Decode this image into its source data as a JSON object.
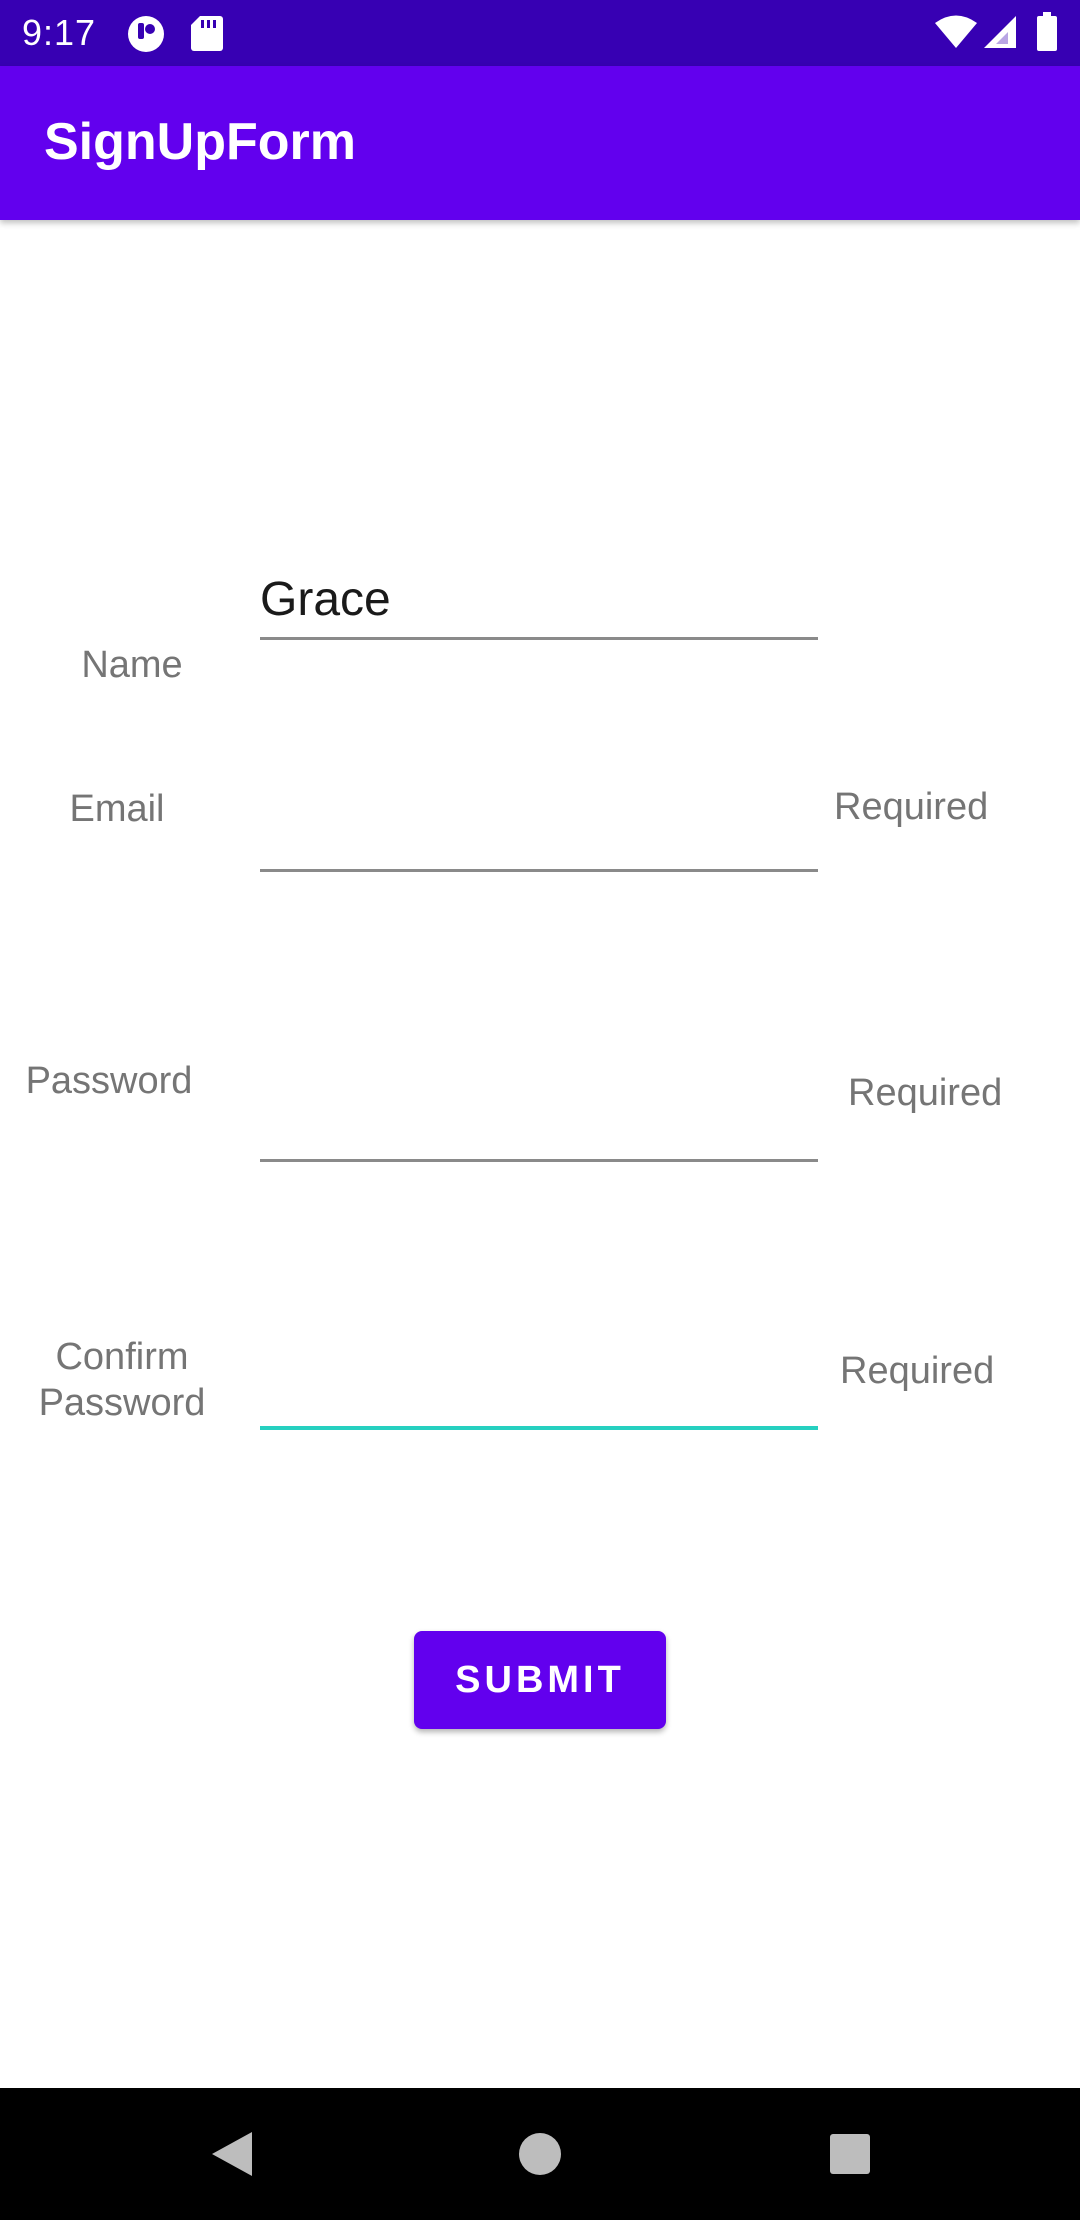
{
  "status_bar": {
    "time": "9:17",
    "icons": [
      "notification-app-icon",
      "sd-card-icon",
      "wifi-icon",
      "signal-icon",
      "battery-icon"
    ]
  },
  "app_bar": {
    "title": "SignUpForm"
  },
  "form": {
    "name": {
      "label": "Name",
      "value": "Grace",
      "error": ""
    },
    "email": {
      "label": "Email",
      "value": "",
      "error": "Required"
    },
    "password": {
      "label": "Password",
      "value": "",
      "error": "Required"
    },
    "confirm_password": {
      "label_line1": "Confirm",
      "label_line2": "Password",
      "value": "",
      "error": "Required"
    },
    "submit_label": "SUBMIT"
  },
  "colors": {
    "status_bar": "#3700b3",
    "primary": "#6200ee",
    "focus_accent": "#26d0c0",
    "label_text": "#757575"
  },
  "nav_bar": {
    "buttons": [
      "back-icon",
      "home-icon",
      "recents-icon"
    ]
  }
}
